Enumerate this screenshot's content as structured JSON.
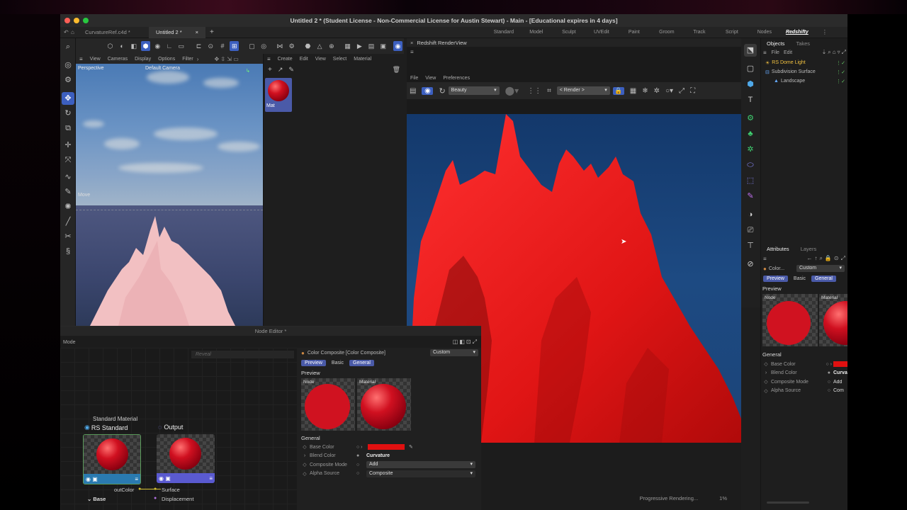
{
  "window": {
    "title": "Untitled 2 * (Student License - Non-Commercial License for Austin Stewart) - Main - [Educational expires in 4 days]"
  },
  "doc_tabs": [
    "CurvatureRef.c4d *",
    "Untitled 2 *"
  ],
  "layouts": [
    "Standard",
    "Model",
    "Sculpt",
    "UVEdit",
    "Paint",
    "Groom",
    "Track",
    "Script",
    "Nodes",
    "Redshifty"
  ],
  "active_layout": "Redshifty",
  "viewport": {
    "menu": [
      "View",
      "Cameras",
      "Display",
      "Options",
      "Filter"
    ],
    "projection": "Perspective",
    "camera": "Default Camera",
    "move_label": "Move"
  },
  "material_manager": {
    "menu": [
      "Create",
      "Edit",
      "View",
      "Select",
      "Material"
    ],
    "material_name": "Mat"
  },
  "render_view": {
    "title": "Redshift RenderView",
    "menu": [
      "File",
      "View",
      "Preferences"
    ],
    "aov": "Beauty",
    "camera": "< Render >",
    "status": "Progressive Rendering...",
    "progress": "1%"
  },
  "objects_panel": {
    "tabs": [
      "Objects",
      "Takes"
    ],
    "menu": [
      "File",
      "Edit"
    ],
    "items": [
      "RS Dome Light",
      "Subdivision Surface",
      "Landscape"
    ]
  },
  "attributes_panel": {
    "tabs": [
      "Attributes",
      "Layers"
    ],
    "node_label": "Color...",
    "mode": "Custom",
    "pills": [
      "Preview",
      "Basic",
      "General"
    ],
    "preview_label": "Preview",
    "node_thumb": "Node",
    "material_thumb": "Material",
    "general_label": "General",
    "rows": [
      {
        "label": "Base Color",
        "value": ""
      },
      {
        "label": "Blend Color",
        "value": "Curva"
      },
      {
        "label": "Composite Mode",
        "value": "Add"
      },
      {
        "label": "Alpha Source",
        "value": "Com"
      }
    ],
    "base_color": "#e01010"
  },
  "node_editor": {
    "title": "Node Editor *",
    "mode_label": "Mode",
    "reveal_placeholder": "Reveal",
    "node_title": "Color Composite [Color Composite]",
    "node_mode": "Custom",
    "pills": [
      "Preview",
      "Basic",
      "General"
    ],
    "preview_label": "Preview",
    "node_thumb": "Node",
    "material_thumb": "Material",
    "general_label": "General",
    "rows": [
      {
        "label": "Base Color",
        "value": ""
      },
      {
        "label": "Blend Color",
        "value": "Curvature"
      },
      {
        "label": "Composite Mode",
        "value": "Add"
      },
      {
        "label": "Alpha Source",
        "value": "Composite"
      }
    ],
    "base_color": "#e01010",
    "graph": {
      "std_caption": "Standard Material",
      "std_name": "RS Standard",
      "out_name": "Output",
      "port_out": "outColor",
      "port_surface": "Surface",
      "port_base": "Base",
      "port_displacement": "Displacement"
    }
  }
}
